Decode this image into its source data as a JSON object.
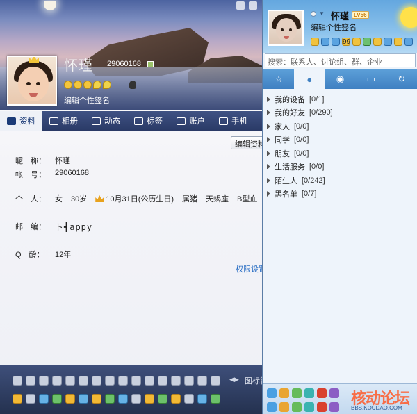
{
  "profile": {
    "nickname": "怀瑾",
    "qq_number": "29060168",
    "signature": "编辑个性签名",
    "tabs": [
      {
        "label": "资料",
        "icon": "card-icon"
      },
      {
        "label": "相册",
        "icon": "photo-icon"
      },
      {
        "label": "动态",
        "icon": "feed-icon"
      },
      {
        "label": "标签",
        "icon": "bookmark-icon"
      },
      {
        "label": "账户",
        "icon": "wallet-icon"
      },
      {
        "label": "手机",
        "icon": "phone-icon"
      }
    ],
    "edit_button": "编辑资料",
    "fields": {
      "nickname_label": "昵　称：",
      "nickname_value": "怀瑾",
      "account_label": "帐　号：",
      "account_value": "29060168",
      "personal_label": "个　人：",
      "gender": "女",
      "age": "30岁",
      "birthday": "10月31日(公历生日)",
      "zodiac": "属猪",
      "constellation": "天蝎座",
      "blood": "B型血",
      "postcode_label": "邮　编：",
      "postcode_value": "ト┫appy",
      "qage_label": "Q　龄：",
      "qage_value": "12年"
    },
    "permission_link": "权限设置",
    "emoji_more": "图标管"
  },
  "qq": {
    "name": "怀瑾",
    "level": "LV56",
    "signature": "编辑个性签名",
    "mail_count": "99",
    "search_placeholder": "搜索：联系人、讨论组、群、企业",
    "groups": [
      {
        "name": "我的设备",
        "count": "[0/1]"
      },
      {
        "name": "我的好友",
        "count": "[0/290]"
      },
      {
        "name": "家人",
        "count": "[0/0]"
      },
      {
        "name": "同学",
        "count": "[0/0]"
      },
      {
        "name": "朋友",
        "count": "[0/0]"
      },
      {
        "name": "生活服务",
        "count": "[0/0]"
      },
      {
        "name": "陌生人",
        "count": "[0/242]"
      },
      {
        "name": "黑名单",
        "count": "[0/7]"
      }
    ]
  },
  "watermark": {
    "text": "核动论坛",
    "url": "BBS.KOUDAO.COM"
  },
  "colors": {
    "accent": "#3f80c2",
    "tabbar": "#2a3a66",
    "link": "#2a6ec4"
  }
}
